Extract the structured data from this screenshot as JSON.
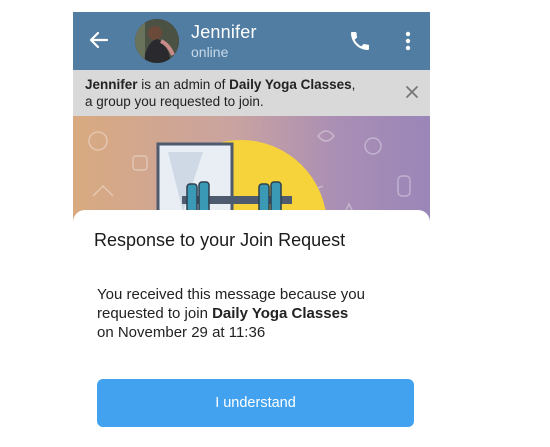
{
  "header": {
    "name": "Jennifer",
    "status": "online",
    "back_icon": "arrow-left-icon",
    "call_icon": "phone-icon",
    "menu_icon": "more-vertical-icon",
    "color": "#517da2"
  },
  "banner": {
    "admin_name": "Jennifer",
    "text_middle": " is an admin of ",
    "group_name": "Daily Yoga Classes",
    "text_end": ",",
    "line2": "a group you requested to join.",
    "close_icon": "close-icon"
  },
  "dialog": {
    "title": "Response to your Join Request",
    "line1": "You received this message because you",
    "line2_prefix": "requested to join ",
    "group_name": "Daily Yoga Classes",
    "line3": "on November 29 at 11:36",
    "button_label": "I understand",
    "button_color": "#43a2f0"
  }
}
